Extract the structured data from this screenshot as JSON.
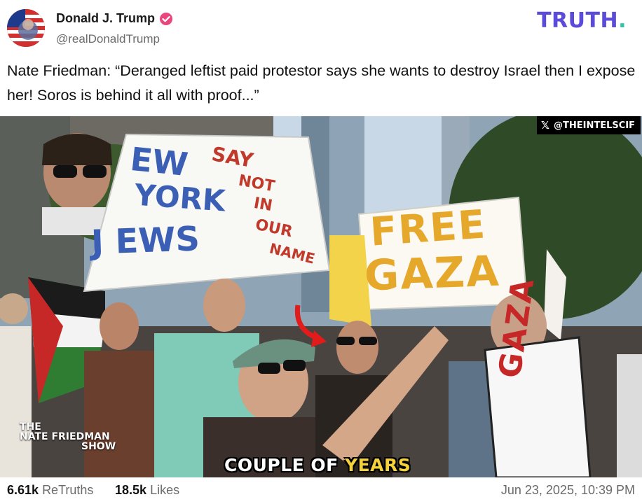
{
  "post": {
    "author_name": "Donald J. Trump",
    "author_handle": "@realDonaldTrump",
    "brand": "TRUTH",
    "brand_dot": ".",
    "text": "Nate Friedman: “Deranged leftist paid protestor says she wants to destroy Israel then I expose her! Soros is behind it all with proof...”"
  },
  "media": {
    "watermark_x": "𝕏",
    "watermark_label": "@THEINTELSCIF",
    "show_logo_line1": "THE",
    "show_logo_line2": "NATE FRIEDMAN",
    "show_logo_line3": "SHOW",
    "caption_part1": "COUPLE OF ",
    "caption_part2": "YEARS",
    "sign1": [
      "EW",
      "SAY",
      "YORK",
      "NOT",
      "IN",
      "J EWS",
      "OUR",
      "NAME"
    ],
    "sign2": [
      "FREE",
      "GAZA"
    ],
    "sign3": "GAZA"
  },
  "stats": {
    "retruths_count": "6.61k",
    "retruths_label": "ReTruths",
    "likes_count": "18.5k",
    "likes_label": "Likes",
    "timestamp": "Jun 23, 2025, 10:39 PM"
  },
  "colors": {
    "brand": "#5b4bdb",
    "brand_dot": "#2ec4a6",
    "verified": "#e8467c",
    "caption_highlight": "#f6d23a"
  }
}
